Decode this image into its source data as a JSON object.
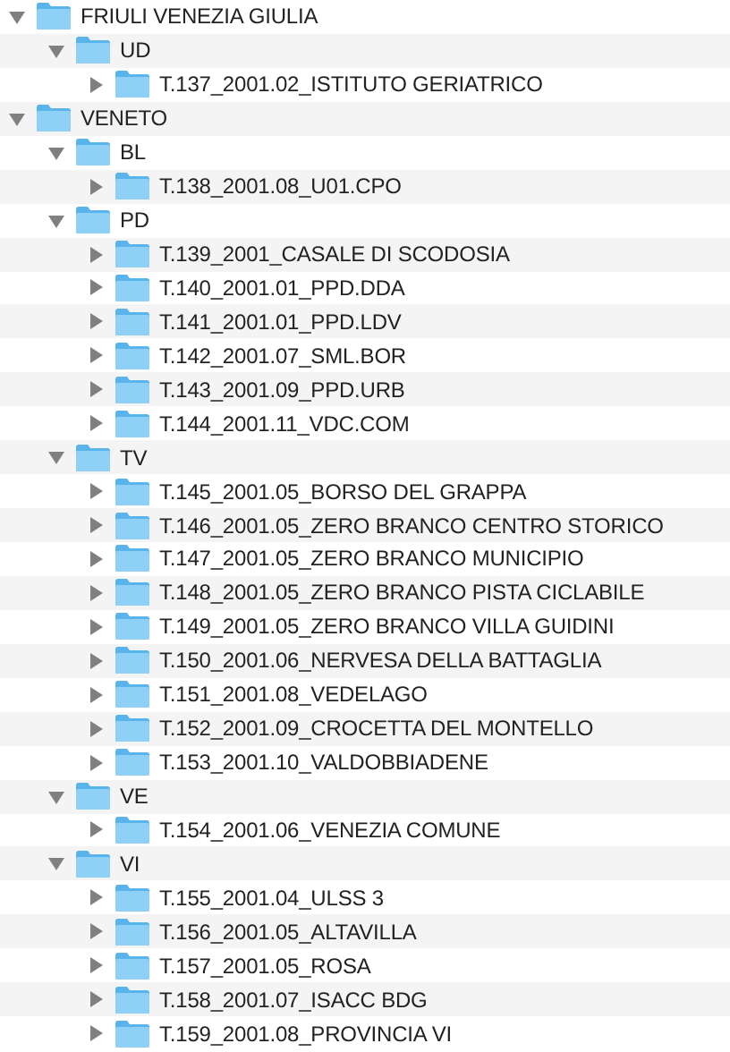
{
  "tree": [
    {
      "name": "FRIULI VENEZIA GIULIA",
      "expanded": true,
      "children": [
        {
          "name": "UD",
          "expanded": true,
          "children": [
            {
              "name": "T.137_2001.02_ISTITUTO GERIATRICO",
              "expanded": false
            }
          ]
        }
      ]
    },
    {
      "name": "VENETO",
      "expanded": true,
      "children": [
        {
          "name": "BL",
          "expanded": true,
          "children": [
            {
              "name": "T.138_2001.08_U01.CPO",
              "expanded": false
            }
          ]
        },
        {
          "name": "PD",
          "expanded": true,
          "children": [
            {
              "name": "T.139_2001_CASALE DI SCODOSIA",
              "expanded": false
            },
            {
              "name": "T.140_2001.01_PPD.DDA",
              "expanded": false
            },
            {
              "name": "T.141_2001.01_PPD.LDV",
              "expanded": false
            },
            {
              "name": "T.142_2001.07_SML.BOR",
              "expanded": false
            },
            {
              "name": "T.143_2001.09_PPD.URB",
              "expanded": false
            },
            {
              "name": "T.144_2001.11_VDC.COM",
              "expanded": false
            }
          ]
        },
        {
          "name": "TV",
          "expanded": true,
          "children": [
            {
              "name": "T.145_2001.05_BORSO DEL GRAPPA",
              "expanded": false
            },
            {
              "name": "T.146_2001.05_ZERO BRANCO CENTRO STORICO",
              "expanded": false
            },
            {
              "name": "T.147_2001.05_ZERO BRANCO MUNICIPIO",
              "expanded": false
            },
            {
              "name": "T.148_2001.05_ZERO BRANCO PISTA CICLABILE",
              "expanded": false
            },
            {
              "name": "T.149_2001.05_ZERO BRANCO VILLA GUIDINI",
              "expanded": false
            },
            {
              "name": "T.150_2001.06_NERVESA DELLA BATTAGLIA",
              "expanded": false
            },
            {
              "name": "T.151_2001.08_VEDELAGO",
              "expanded": false
            },
            {
              "name": "T.152_2001.09_CROCETTA DEL MONTELLO",
              "expanded": false
            },
            {
              "name": "T.153_2001.10_VALDOBBIADENE",
              "expanded": false
            }
          ]
        },
        {
          "name": "VE",
          "expanded": true,
          "children": [
            {
              "name": "T.154_2001.06_VENEZIA COMUNE",
              "expanded": false
            }
          ]
        },
        {
          "name": "VI",
          "expanded": true,
          "children": [
            {
              "name": "T.155_2001.04_ULSS 3",
              "expanded": false
            },
            {
              "name": "T.156_2001.05_ALTAVILLA",
              "expanded": false
            },
            {
              "name": "T.157_2001.05_ROSA",
              "expanded": false
            },
            {
              "name": "T.158_2001.07_ISACC BDG",
              "expanded": false
            },
            {
              "name": "T.159_2001.08_PROVINCIA VI",
              "expanded": false
            }
          ]
        }
      ]
    }
  ]
}
